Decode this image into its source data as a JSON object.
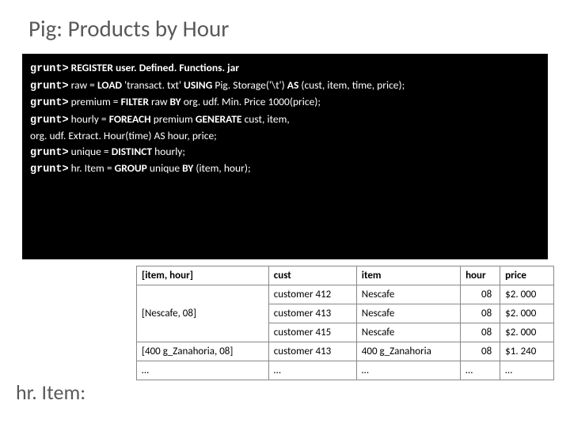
{
  "title": "Pig: Products by Hour",
  "prompt": "grunt>",
  "code": {
    "l1": " REGISTER user. Defined. Functions. jar",
    "l2a": " raw = ",
    "l2b": "LOAD",
    "l2c": " 'transact. txt' ",
    "l2d": "USING",
    "l2e": " Pig. Storage('\\t') ",
    "l2f": "AS",
    "l2g": " (cust, item, time, price);",
    "l3a": " premium = ",
    "l3b": "FILTER",
    "l3c": " raw ",
    "l3d": "BY",
    "l3e": " org. udf. Min. Price 1000(price);",
    "l4a": " hourly = ",
    "l4b": "FOREACH",
    "l4c": " premium ",
    "l4d": "GENERATE",
    "l4e": " cust, item,",
    "l5": "org. udf. Extract. Hour(time) AS hour, price;",
    "l6a": " unique = ",
    "l6b": "DISTINCT",
    "l6c": " hourly;",
    "l7a": " hr. Item = ",
    "l7b": "GROUP",
    "l7c": " unique ",
    "l7d": "BY",
    "l7e": " (item, hour);"
  },
  "table": {
    "headers": {
      "c0": "[item, hour]",
      "c1": "cust",
      "c2": "item",
      "c3": "hour",
      "c4": "price"
    },
    "rows": [
      {
        "key": "[Nescafe, 08]",
        "cust": "customer 412",
        "item": "Nescafe",
        "hour": "08",
        "price": "$2. 000"
      },
      {
        "key": "",
        "cust": "customer 413",
        "item": "Nescafe",
        "hour": "08",
        "price": "$2. 000"
      },
      {
        "key": "",
        "cust": "customer 415",
        "item": "Nescafe",
        "hour": "08",
        "price": "$2. 000"
      },
      {
        "key": "[400 g_Zanahoria, 08]",
        "cust": "customer 413",
        "item": "400 g_Zanahoria",
        "hour": "08",
        "price": "$1. 240"
      },
      {
        "key": "…",
        "cust": "…",
        "item": "…",
        "hour": "…",
        "price": "…"
      }
    ]
  },
  "hrlabel": "hr. Item:"
}
